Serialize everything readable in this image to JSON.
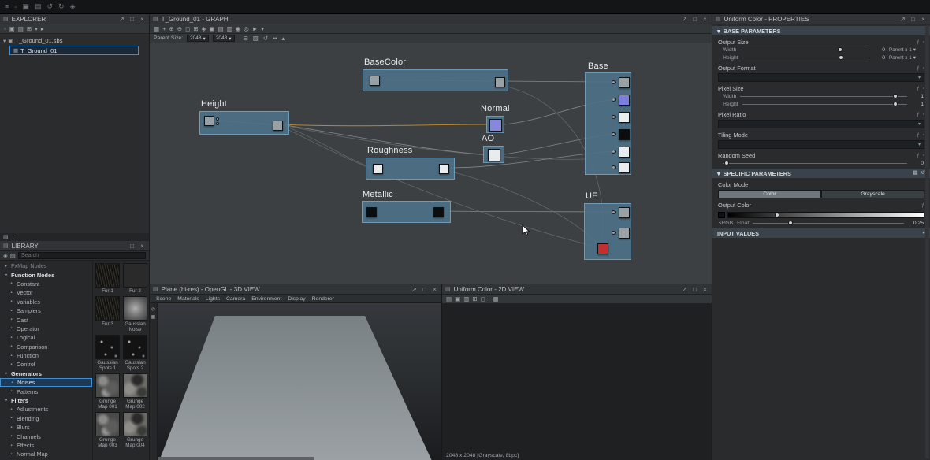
{
  "colors": {
    "graph_bg": "#3c4043",
    "node_frame": "#4e7187",
    "accent_blue": "#3f8fd4",
    "wire": "#94989b",
    "wire_orange": "#c0892f",
    "node_red": "#c22f2f",
    "node_purple": "#8787dc",
    "selection": "#3f8fd4"
  },
  "chrome": {
    "float_icon": "↗",
    "max_icon": "□",
    "close_icon": "×",
    "chevron_down": "▾",
    "chevron_right": "▸",
    "panel_icon": "▤",
    "fx_icon": "ƒ",
    "dot_icon": "▫",
    "package_icon": "▣",
    "graph_icon": "▦"
  },
  "top_bar": {
    "icons": [
      {
        "name": "app-menu-icon",
        "glyph": "≡"
      },
      {
        "name": "new-file-icon",
        "glyph": "▫"
      },
      {
        "name": "open-file-icon",
        "glyph": "▣"
      },
      {
        "name": "save-icon",
        "glyph": "▤"
      },
      {
        "name": "undo-icon",
        "glyph": "↺"
      },
      {
        "name": "redo-icon",
        "glyph": "↻"
      },
      {
        "name": "settings-icon",
        "glyph": "◈"
      }
    ]
  },
  "explorer": {
    "title": "EXPLORER",
    "toolbar_icons": [
      {
        "name": "new-package-icon",
        "glyph": "▫"
      },
      {
        "name": "open-package-icon",
        "glyph": "▣"
      },
      {
        "name": "save-package-icon",
        "glyph": "▤"
      },
      {
        "name": "link-package-icon",
        "glyph": "⊞"
      },
      {
        "name": "expand-all-icon",
        "glyph": "▾"
      },
      {
        "name": "collapse-all-icon",
        "glyph": "▸"
      }
    ],
    "root_label": "T_Ground_01.sbs",
    "child_label": "T_Ground_01"
  },
  "library": {
    "title": "LIBRARY",
    "search_placeholder": "Search",
    "search_icons": [
      {
        "name": "filter-icon",
        "glyph": "◈"
      },
      {
        "name": "edit-presets-icon",
        "glyph": "▨"
      }
    ],
    "strip_icons": [
      {
        "name": "panel-tab-icon",
        "glyph": "▤"
      },
      {
        "name": "info-icon",
        "glyph": "i"
      }
    ],
    "tree": [
      {
        "label": "FxMap Nodes",
        "cls": "dim",
        "glyph": "▸"
      },
      {
        "label": "Function Nodes",
        "cls": "cat",
        "glyph": "▾"
      },
      {
        "label": "Constant",
        "cls": "item",
        "glyph": "▪"
      },
      {
        "label": "Vector",
        "cls": "item",
        "glyph": "▪"
      },
      {
        "label": "Variables",
        "cls": "item",
        "glyph": "▪"
      },
      {
        "label": "Samplers",
        "cls": "item",
        "glyph": "▪"
      },
      {
        "label": "Cast",
        "cls": "item",
        "glyph": "▪"
      },
      {
        "label": "Operator",
        "cls": "item",
        "glyph": "▪"
      },
      {
        "label": "Logical",
        "cls": "item",
        "glyph": "▪"
      },
      {
        "label": "Comparison",
        "cls": "item",
        "glyph": "▪"
      },
      {
        "label": "Function",
        "cls": "item",
        "glyph": "▪"
      },
      {
        "label": "Control",
        "cls": "item",
        "glyph": "▪"
      },
      {
        "label": "Generators",
        "cls": "cat",
        "glyph": "▾"
      },
      {
        "label": "Noises",
        "cls": "item selected",
        "glyph": "▪"
      },
      {
        "label": "Patterns",
        "cls": "item",
        "glyph": "▪"
      },
      {
        "label": "Filters",
        "cls": "cat",
        "glyph": "▾"
      },
      {
        "label": "Adjustments",
        "cls": "item",
        "glyph": "▪"
      },
      {
        "label": "Blending",
        "cls": "item",
        "glyph": "▪"
      },
      {
        "label": "Blurs",
        "cls": "item",
        "glyph": "▪"
      },
      {
        "label": "Channels",
        "cls": "item",
        "glyph": "▪"
      },
      {
        "label": "Effects",
        "cls": "item",
        "glyph": "▪"
      },
      {
        "label": "Normal Map",
        "cls": "item",
        "glyph": "▪"
      }
    ],
    "thumbnails": [
      {
        "label": "Fur 1",
        "cls": "thumb-fur"
      },
      {
        "label": "Fur 2",
        "cls": "thumb-fur2"
      },
      {
        "label": "Fur 3",
        "cls": "thumb-fur"
      },
      {
        "label": "Gaussian Noise",
        "cls": "thumb-gauss"
      },
      {
        "label": "Gaussian Spots 1",
        "cls": "thumb-spots"
      },
      {
        "label": "Gaussian Spots 2",
        "cls": "thumb-spots"
      },
      {
        "label": "Grunge Map 001",
        "cls": "thumb-grunge"
      },
      {
        "label": "Grunge Map 002",
        "cls": "thumb-grunge2"
      },
      {
        "label": "Grunge Map 003",
        "cls": "thumb-grunge"
      },
      {
        "label": "Grunge Map 004",
        "cls": "thumb-grunge2"
      }
    ]
  },
  "graph": {
    "title": "T_Ground_01 - GRAPH",
    "toolbar_icons": [
      {
        "name": "pointer-tool-icon",
        "glyph": "▦"
      },
      {
        "name": "pan-tool-icon",
        "glyph": "+"
      },
      {
        "name": "zoom-in-icon",
        "glyph": "⊕"
      },
      {
        "name": "zoom-out-icon",
        "glyph": "⊖"
      },
      {
        "name": "fit-view-icon",
        "glyph": "◻"
      },
      {
        "name": "grid-toggle-icon",
        "glyph": "⊞"
      },
      {
        "name": "snap-toggle-icon",
        "glyph": "◈"
      },
      {
        "name": "add-node-icon",
        "glyph": "▣"
      },
      {
        "name": "add-comment-icon",
        "glyph": "▤"
      },
      {
        "name": "add-frame-icon",
        "glyph": "▥"
      },
      {
        "name": "pin-view-icon",
        "glyph": "◉"
      },
      {
        "name": "link-view-icon",
        "glyph": "◎"
      },
      {
        "name": "play-icon",
        "glyph": "►"
      },
      {
        "name": "filter-nodes-icon",
        "glyph": "▾"
      }
    ],
    "toolbar2": {
      "parent_size_label": "Parent Size:",
      "parent_size_value": "2048",
      "size_value": "2048"
    },
    "toolbar2_icons": [
      {
        "name": "lock-size-icon",
        "glyph": "⊟"
      },
      {
        "name": "edit-size-icon",
        "glyph": "▨"
      },
      {
        "name": "refresh-icon",
        "glyph": "↺"
      },
      {
        "name": "pause-icon",
        "glyph": "▪▪"
      },
      {
        "name": "home-view-icon",
        "glyph": "▴"
      }
    ],
    "labels": {
      "basecolor": "BaseColor",
      "height": "Height",
      "normal": "Normal",
      "ao": "AO",
      "roughness": "Roughness",
      "metallic": "Metallic",
      "base": "Base",
      "ue": "UE"
    }
  },
  "view3d": {
    "title": "Plane (hi-res) - OpenGL - 3D VIEW",
    "menus": [
      "Scene",
      "Materials",
      "Lights",
      "Camera",
      "Environment",
      "Display",
      "Renderer"
    ],
    "strip_icons": [
      {
        "name": "camera-preset-icon",
        "glyph": "◎"
      },
      {
        "name": "display-mode-icon",
        "glyph": "▦"
      }
    ]
  },
  "view2d": {
    "title": "Uniform Color - 2D VIEW",
    "toolbar_icons": [
      {
        "name": "save-image-icon",
        "glyph": "▤"
      },
      {
        "name": "export-image-icon",
        "glyph": "▣"
      },
      {
        "name": "channels-icon",
        "glyph": "▥"
      },
      {
        "name": "tiling-icon",
        "glyph": "⊞"
      },
      {
        "name": "zoom-fit-icon",
        "glyph": "◻"
      },
      {
        "name": "info-icon",
        "glyph": "i"
      },
      {
        "name": "grid-icon",
        "glyph": "▦"
      }
    ],
    "status": "2048 x 2048 [Grayscale, 8bpc]"
  },
  "properties": {
    "title": "Uniform Color - PROPERTIES",
    "sections": {
      "base": "BASE PARAMETERS",
      "specific": "SPECIFIC PARAMETERS",
      "input": "INPUT VALUES"
    },
    "specific_icons": [
      {
        "name": "preset-icon",
        "glyph": "▤"
      },
      {
        "name": "reset-icon",
        "glyph": "↺"
      }
    ],
    "input_icons": [
      {
        "name": "add-input-icon",
        "glyph": "●"
      }
    ],
    "output_size": {
      "label": "Output Size",
      "width_label": "Width",
      "width_value": "0",
      "width_mode": "Parent x 1",
      "height_label": "Height",
      "height_value": "0",
      "height_mode": "Parent x 1"
    },
    "output_format": {
      "label": "Output Format"
    },
    "pixel_size": {
      "label": "Pixel Size",
      "width_label": "Width",
      "width_value": "1",
      "height_label": "Height",
      "height_value": "1"
    },
    "pixel_ratio": {
      "label": "Pixel Ratio"
    },
    "tiling_mode": {
      "label": "Tiling Mode"
    },
    "random_seed": {
      "label": "Random Seed",
      "value": "0"
    },
    "color_mode": {
      "label": "Color Mode",
      "color": "Color",
      "grayscale": "Grayscale"
    },
    "output_color": {
      "label": "Output Color",
      "srgb": "sRGB",
      "float": "Float",
      "value": "0.25"
    }
  }
}
